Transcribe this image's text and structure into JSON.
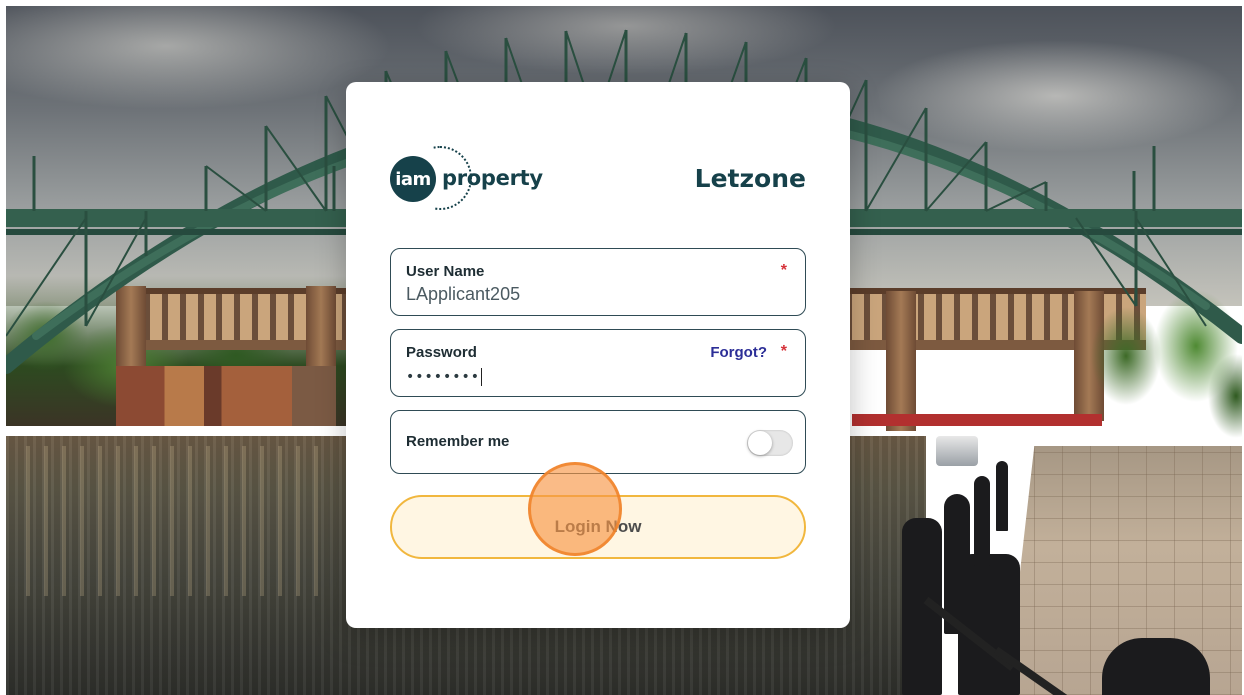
{
  "brand": {
    "logo_mark": "iam",
    "logo_word": "property",
    "app_name": "Letzone"
  },
  "login_form": {
    "username": {
      "label": "User Name",
      "value": "LApplicant205",
      "required_marker": "*"
    },
    "password": {
      "label": "Password",
      "masked_value": "••••••••",
      "forgot_link": "Forgot?",
      "required_marker": "*"
    },
    "remember": {
      "label": "Remember me",
      "enabled": false
    },
    "submit_label": "Login Now"
  },
  "colors": {
    "brand_dark": "#16414a",
    "required": "#d6323a",
    "link": "#2c2e97",
    "button_border": "#f1b73e",
    "button_fill": "#fff6e3",
    "click_indicator": "#f89646"
  },
  "icons": {
    "brand_logo": "iam-property-logo-icon",
    "toggle": "toggle-switch-icon"
  }
}
